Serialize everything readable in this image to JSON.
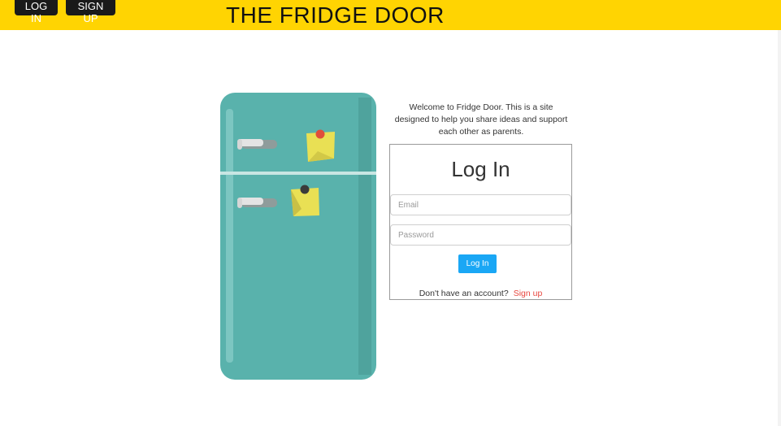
{
  "header": {
    "title": "THE FRIDGE DOOR",
    "login_label": "LOG IN",
    "signup_label": "SIGN UP",
    "bg_color": "#FFD402"
  },
  "welcome_text": "Welcome to Fridge Door. This is a site designed to help you share ideas and support each other as parents.",
  "login_form": {
    "title": "Log In",
    "email_placeholder": "Email",
    "password_placeholder": "Password",
    "submit_label": "Log In",
    "no_account_text": "Don't have an account?",
    "signup_link": "Sign up"
  },
  "colors": {
    "fridge": "#59B2AC",
    "accent_button": "#1AA7F5",
    "link": "#E8473F"
  }
}
